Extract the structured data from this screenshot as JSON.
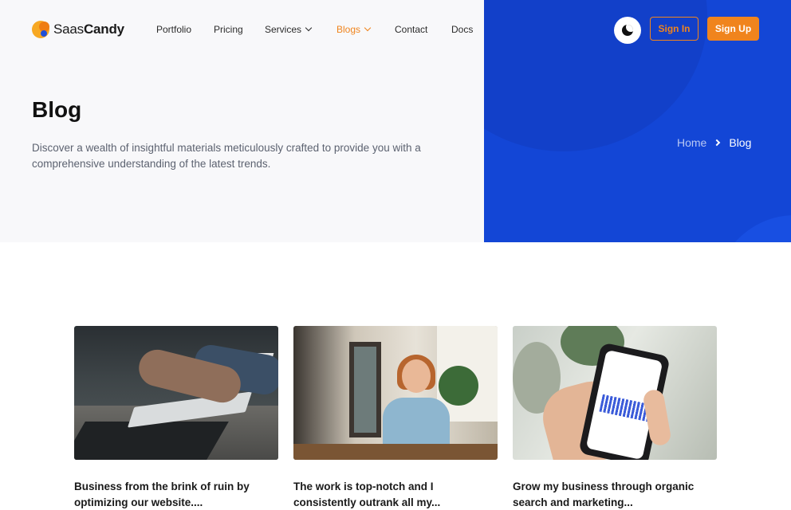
{
  "brand": {
    "name_light": "Saas",
    "name_bold": "Candy"
  },
  "nav": {
    "items": [
      {
        "label": "Portfolio",
        "dropdown": false,
        "active": false
      },
      {
        "label": "Pricing",
        "dropdown": false,
        "active": false
      },
      {
        "label": "Services",
        "dropdown": true,
        "active": false
      },
      {
        "label": "Blogs",
        "dropdown": true,
        "active": true
      },
      {
        "label": "Contact",
        "dropdown": false,
        "active": false
      },
      {
        "label": "Docs",
        "dropdown": false,
        "active": false
      }
    ],
    "theme_toggle_icon": "moon-icon",
    "signin_label": "Sign In",
    "signup_label": "Sign Up"
  },
  "hero": {
    "title": "Blog",
    "description": "Discover a wealth of insightful materials meticulously crafted to provide you with a comprehensive understanding of the latest trends.",
    "breadcrumb": {
      "home": "Home",
      "current": "Blog"
    }
  },
  "posts": [
    {
      "title": "Business from the brink of ruin by optimizing our website....",
      "image": "typing-keyboard-photo"
    },
    {
      "title": "The work is top-notch and I consistently outrank all my...",
      "image": "smiling-woman-photo"
    },
    {
      "title": "Grow my business through organic search and marketing...",
      "image": "phone-analytics-photo"
    }
  ],
  "colors": {
    "accent": "#f0841d",
    "hero_blue": "#1346d6",
    "hero_light": "#f8f8fa",
    "text": "#1a1a1a",
    "muted": "#5c6270"
  }
}
